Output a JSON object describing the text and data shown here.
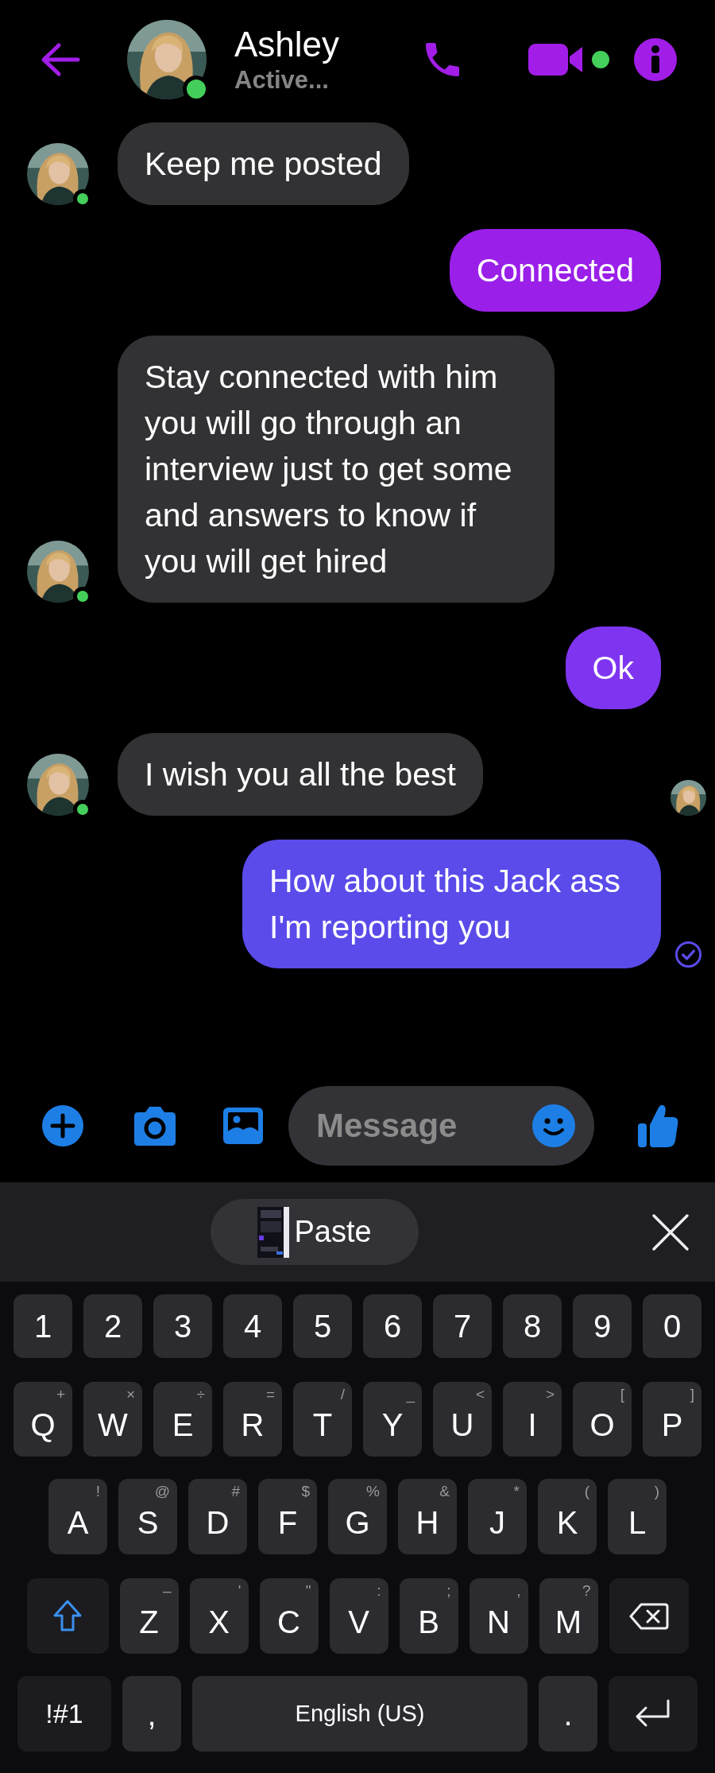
{
  "header": {
    "name": "Ashley",
    "status": "Active...",
    "online": true,
    "video_active": true
  },
  "messages": [
    {
      "kind": "incoming",
      "text": "Keep me posted",
      "avatar": true,
      "online": true
    },
    {
      "kind": "outgoing",
      "text": "Connected",
      "color": "#9a1fe9"
    },
    {
      "kind": "incoming",
      "text": "Stay connected with him you will go through an interview just to get some and answers to know if you will get hired",
      "avatar": true,
      "online": true
    },
    {
      "kind": "outgoing",
      "text": "Ok",
      "color": "#7f35f0"
    },
    {
      "kind": "incoming",
      "text": "I wish you all the best",
      "avatar": true,
      "online": true,
      "seen": true
    },
    {
      "kind": "outgoing",
      "text": "How about this Jack ass I'm reporting you",
      "color": "#5a4bea",
      "delivered": true
    }
  ],
  "composer": {
    "placeholder": "Message"
  },
  "keyboard": {
    "paste_label": "Paste",
    "rows": [
      {
        "keys": [
          {
            "kind": "char",
            "label": "1"
          },
          {
            "kind": "char",
            "label": "2"
          },
          {
            "kind": "char",
            "label": "3"
          },
          {
            "kind": "char",
            "label": "4"
          },
          {
            "kind": "char",
            "label": "5"
          },
          {
            "kind": "char",
            "label": "6"
          },
          {
            "kind": "char",
            "label": "7"
          },
          {
            "kind": "char",
            "label": "8"
          },
          {
            "kind": "char",
            "label": "9"
          },
          {
            "kind": "char",
            "label": "0"
          }
        ]
      },
      {
        "keys": [
          {
            "kind": "char",
            "label": "Q",
            "hint": "+"
          },
          {
            "kind": "char",
            "label": "W",
            "hint": "×"
          },
          {
            "kind": "char",
            "label": "E",
            "hint": "÷"
          },
          {
            "kind": "char",
            "label": "R",
            "hint": "="
          },
          {
            "kind": "char",
            "label": "T",
            "hint": "/"
          },
          {
            "kind": "char",
            "label": "Y",
            "hint": "_"
          },
          {
            "kind": "char",
            "label": "U",
            "hint": "<"
          },
          {
            "kind": "char",
            "label": "I",
            "hint": ">"
          },
          {
            "kind": "char",
            "label": "O",
            "hint": "["
          },
          {
            "kind": "char",
            "label": "P",
            "hint": "]"
          }
        ]
      },
      {
        "keys": [
          {
            "kind": "char",
            "label": "A",
            "hint": "!"
          },
          {
            "kind": "char",
            "label": "S",
            "hint": "@"
          },
          {
            "kind": "char",
            "label": "D",
            "hint": "#"
          },
          {
            "kind": "char",
            "label": "F",
            "hint": "$"
          },
          {
            "kind": "char",
            "label": "G",
            "hint": "%"
          },
          {
            "kind": "char",
            "label": "H",
            "hint": "&"
          },
          {
            "kind": "char",
            "label": "J",
            "hint": "*"
          },
          {
            "kind": "char",
            "label": "K",
            "hint": "("
          },
          {
            "kind": "char",
            "label": "L",
            "hint": ")"
          }
        ]
      },
      {
        "keys": [
          {
            "kind": "shift"
          },
          {
            "kind": "char",
            "label": "Z",
            "hint": "–"
          },
          {
            "kind": "char",
            "label": "X",
            "hint": "'"
          },
          {
            "kind": "char",
            "label": "C",
            "hint": "\""
          },
          {
            "kind": "char",
            "label": "V",
            "hint": ":"
          },
          {
            "kind": "char",
            "label": "B",
            "hint": ";"
          },
          {
            "kind": "char",
            "label": "N",
            "hint": ","
          },
          {
            "kind": "char",
            "label": "M",
            "hint": "?"
          },
          {
            "kind": "backspace"
          }
        ]
      },
      {
        "keys": [
          {
            "kind": "symbols",
            "label": "!#1"
          },
          {
            "kind": "char",
            "label": ","
          },
          {
            "kind": "space",
            "label": "English (US)"
          },
          {
            "kind": "char",
            "label": "."
          },
          {
            "kind": "enter"
          }
        ]
      }
    ]
  }
}
